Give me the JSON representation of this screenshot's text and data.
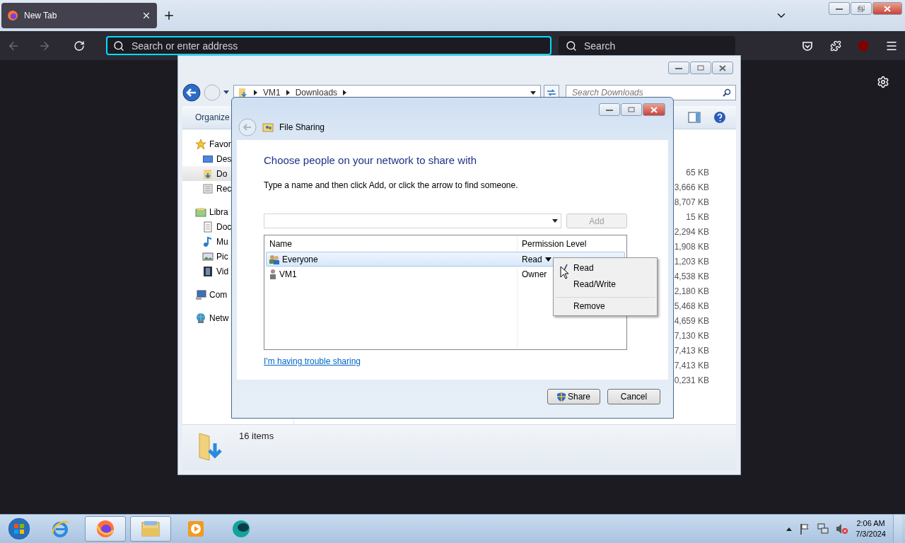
{
  "browser": {
    "tabs": [
      {
        "title": "New Tab",
        "selected": true
      }
    ],
    "address": {
      "placeholder": "Search or enter address"
    },
    "search": {
      "placeholder": "Search"
    }
  },
  "explorer": {
    "breadcrumb": [
      "VM1",
      "Downloads"
    ],
    "search": {
      "placeholder": "Search Downloads"
    },
    "toolbar": [
      "Organize"
    ],
    "sidebar": [
      {
        "label": "Favor",
        "kind": "star",
        "selected": false,
        "children": [
          {
            "label": "Des",
            "kind": "desktop",
            "selected": false
          },
          {
            "label": "Do",
            "kind": "downloads",
            "selected": true
          },
          {
            "label": "Rec",
            "kind": "recent",
            "selected": false
          }
        ]
      },
      {
        "label": "Libra",
        "kind": "library",
        "selected": false,
        "children": [
          {
            "label": "Doc",
            "kind": "document",
            "selected": false
          },
          {
            "label": "Mu",
            "kind": "music",
            "selected": false
          },
          {
            "label": "Pic",
            "kind": "pictures",
            "selected": false
          },
          {
            "label": "Vid",
            "kind": "video",
            "selected": false
          }
        ]
      },
      {
        "label": "Com",
        "kind": "computer",
        "selected": false
      },
      {
        "label": "Netw",
        "kind": "network",
        "selected": false
      }
    ],
    "sizes": [
      "65 KB",
      "3,666 KB",
      "8,707 KB",
      "15 KB",
      "2,294 KB",
      "1,908 KB",
      "1,203 KB",
      "4,538 KB",
      "2,180 KB",
      "5,468 KB",
      "4,659 KB",
      "7,130 KB",
      "7,413 KB",
      "7,413 KB",
      "0,231 KB"
    ],
    "status": "16 items"
  },
  "dialog": {
    "title": "File Sharing",
    "heading": "Choose people on your network to share with",
    "instruction": "Type a name and then click Add, or click the arrow to find someone.",
    "add_button": {
      "label": "Add",
      "disabled": true
    },
    "columns": [
      "Name",
      "Permission Level"
    ],
    "rows": [
      {
        "name": "Everyone",
        "permission": "Read",
        "kind": "group",
        "selected": true
      },
      {
        "name": "VM1",
        "permission": "Owner",
        "kind": "user",
        "selected": false
      }
    ],
    "link": "I'm having trouble sharing",
    "buttons": [
      {
        "label": "Share",
        "kind": "shield"
      },
      {
        "label": "Cancel",
        "kind": "plain"
      }
    ]
  },
  "permission_menu": {
    "items": [
      {
        "label": "Read",
        "checked": true,
        "separated": false
      },
      {
        "label": "Read/Write",
        "checked": false,
        "separated": false
      },
      {
        "label": "Remove",
        "checked": false,
        "separated": true
      }
    ]
  },
  "taskbar": {
    "apps": [
      {
        "kind": "ie",
        "running": false
      },
      {
        "kind": "firefox",
        "running": true
      },
      {
        "kind": "explorer",
        "running": true
      },
      {
        "kind": "media",
        "running": false
      },
      {
        "kind": "globe",
        "running": false
      }
    ],
    "time": "2:06 AM",
    "date": "7/3/2024"
  }
}
